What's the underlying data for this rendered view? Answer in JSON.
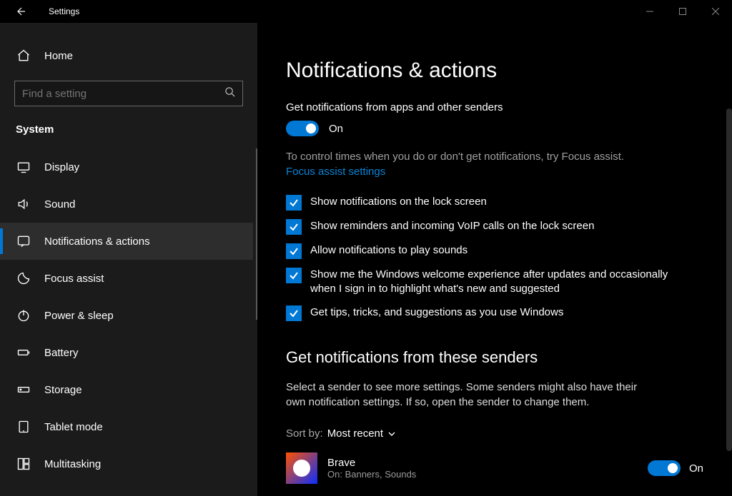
{
  "title_bar": {
    "title": "Settings"
  },
  "sidebar": {
    "home": "Home",
    "search_placeholder": "Find a setting",
    "section": "System",
    "items": [
      {
        "label": "Display"
      },
      {
        "label": "Sound"
      },
      {
        "label": "Notifications & actions"
      },
      {
        "label": "Focus assist"
      },
      {
        "label": "Power & sleep"
      },
      {
        "label": "Battery"
      },
      {
        "label": "Storage"
      },
      {
        "label": "Tablet mode"
      },
      {
        "label": "Multitasking"
      }
    ]
  },
  "page": {
    "title": "Notifications & actions",
    "main_toggle_label": "Get notifications from apps and other senders",
    "toggle_state": "On",
    "hint": "To control times when you do or don't get notifications, try Focus assist.",
    "link": "Focus assist settings",
    "checks": [
      "Show notifications on the lock screen",
      "Show reminders and incoming VoIP calls on the lock screen",
      "Allow notifications to play sounds",
      "Show me the Windows welcome experience after updates and occasionally when I sign in to highlight what's new and suggested",
      "Get tips, tricks, and suggestions as you use Windows"
    ],
    "senders_heading": "Get notifications from these senders",
    "senders_desc": "Select a sender to see more settings. Some senders might also have their own notification settings. If so, open the sender to change them.",
    "sort_label": "Sort by:",
    "sort_value": "Most recent",
    "sender": {
      "name": "Brave",
      "sub": "On: Banners, Sounds",
      "state": "On"
    }
  }
}
